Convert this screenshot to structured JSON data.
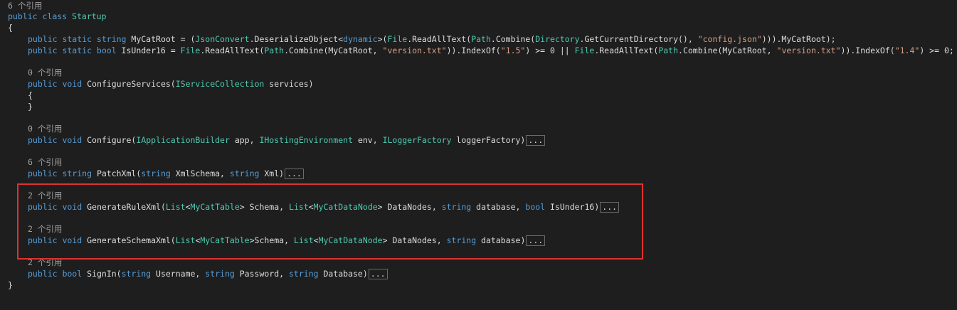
{
  "editor": {
    "ref_class": "6 个引用",
    "class_decl": {
      "kw1": "public",
      "kw2": "class",
      "name": "Startup"
    },
    "brace_open": "{",
    "brace_close": "}",
    "line_root": {
      "p1": "public static string",
      "p2": " MyCatRoot = (",
      "t1": "JsonConvert",
      "p3": ".DeserializeObject<",
      "t2": "dynamic",
      "p4": ">(",
      "t3": "File",
      "p5": ".ReadAllText(",
      "t4": "Path",
      "p6": ".Combine(",
      "t5": "Directory",
      "p7": ".GetCurrentDirectory(), ",
      "s1": "\"config.json\"",
      "p8": "))).MyCatRoot);"
    },
    "line_under": {
      "p1": "public static bool",
      "p2": " IsUnder16 = ",
      "t1": "File",
      "p3": ".ReadAllText(",
      "t2": "Path",
      "p4": ".Combine(MyCatRoot, ",
      "s1": "\"version.txt\"",
      "p5": ")).IndexOf(",
      "s2": "\"1.5\"",
      "p6": ") >= 0 || ",
      "t3": "File",
      "p7": ".ReadAllText(",
      "t4": "Path",
      "p8": ".Combine(MyCatRoot, ",
      "s3": "\"version.txt\"",
      "p9": ")).IndexOf(",
      "s4": "\"1.4\"",
      "p10": ") >= 0;"
    },
    "ref_configure_services": "0 个引用",
    "configure_services": {
      "kw": "public void",
      "name": " ConfigureServices(",
      "t1": "IServiceCollection",
      "rest": " services)"
    },
    "inner_open": "{",
    "inner_close": "}",
    "ref_configure": "0 个引用",
    "configure": {
      "kw": "public void",
      "name": " Configure(",
      "t1": "IApplicationBuilder",
      "p1": " app, ",
      "t2": "IHostingEnvironment",
      "p2": " env, ",
      "t3": "ILoggerFactory",
      "p3": " loggerFactory)"
    },
    "ref_patch": "6 个引用",
    "patch": {
      "kw": "public string",
      "name": " PatchXml(",
      "kw2": "string",
      "p1": " XmlSchema, ",
      "kw3": "string",
      "p2": " Xml)"
    },
    "ref_rule": "2 个引用",
    "rule": {
      "kw": "public void",
      "name": " GenerateRuleXml(",
      "t1": "List",
      "p1": "<",
      "t2": "MyCatTable",
      "p2": "> Schema, ",
      "t3": "List",
      "p3": "<",
      "t4": "MyCatDataNode",
      "p4": "> DataNodes, ",
      "kw2": "string",
      "p5": " database, ",
      "kw3": "bool",
      "p6": " IsUnder16)"
    },
    "ref_schema": "2 个引用",
    "schema": {
      "kw": "public void",
      "name": " GenerateSchemaXml(",
      "t1": "List",
      "p1": "<",
      "t2": "MyCatTable",
      "p2": ">Schema, ",
      "t3": "List",
      "p3": "<",
      "t4": "MyCatDataNode",
      "p4": "> DataNodes, ",
      "kw2": "string",
      "p5": " database)"
    },
    "ref_signin": "2 个引用",
    "signin": {
      "kw": "public bool",
      "name": " SignIn(",
      "kw2": "string",
      "p1": " Username, ",
      "kw3": "string",
      "p2": " Password, ",
      "kw4": "string",
      "p3": " Database)"
    },
    "fold_label": "..."
  },
  "colors": {
    "background": "#1e1e1e",
    "keyword": "#569cd6",
    "type": "#4ec9b0",
    "string": "#d69d85",
    "highlight_box": "#e0312f"
  }
}
